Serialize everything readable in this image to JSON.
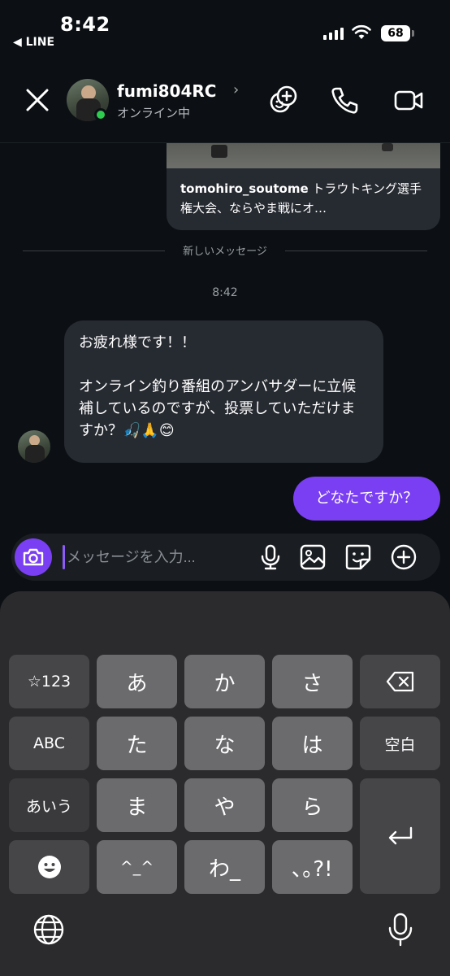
{
  "status_bar": {
    "time": "8:42",
    "back_label": "◀ LINE",
    "battery": "68"
  },
  "header": {
    "username": "fumi804RC",
    "presence": "オンライン中",
    "icons": [
      "close-icon",
      "avatar",
      "add-friend-icon",
      "phone-icon",
      "video-call-icon"
    ]
  },
  "shared_post": {
    "author": "tomohiro_soutome",
    "caption": " トラウトキング選手権大会、ならやま戦にオ…"
  },
  "separator_label": "新しいメッセージ",
  "timestamp": "8:42",
  "messages": [
    {
      "direction": "incoming",
      "text": "お疲れ様です！！\n\nオンライン釣り番組のアンバサダーに立候補しているのですが、投票していただけますか？🎣🙏😊"
    },
    {
      "direction": "outgoing",
      "text": "どなたですか？"
    }
  ],
  "composer": {
    "placeholder": "メッセージを入力...",
    "icons": [
      "camera-icon",
      "microphone-icon",
      "image-icon",
      "sticker-icon",
      "plus-icon"
    ]
  },
  "keyboard": {
    "row1": [
      "☆123",
      "あ",
      "か",
      "さ",
      "⌫"
    ],
    "row2": [
      "ABC",
      "た",
      "な",
      "は",
      "空白"
    ],
    "row3": [
      "あいう",
      "ま",
      "や",
      "ら",
      "↵"
    ],
    "row4": [
      "☻",
      "^_^",
      "わ_",
      "､｡?!"
    ],
    "bottom_icons": [
      "globe-icon",
      "dictation-microphone-icon"
    ]
  },
  "colors": {
    "background": "#0c1014",
    "accent": "#7a3ff2",
    "incoming_bubble": "#262a31",
    "online": "#2ecc4f"
  }
}
